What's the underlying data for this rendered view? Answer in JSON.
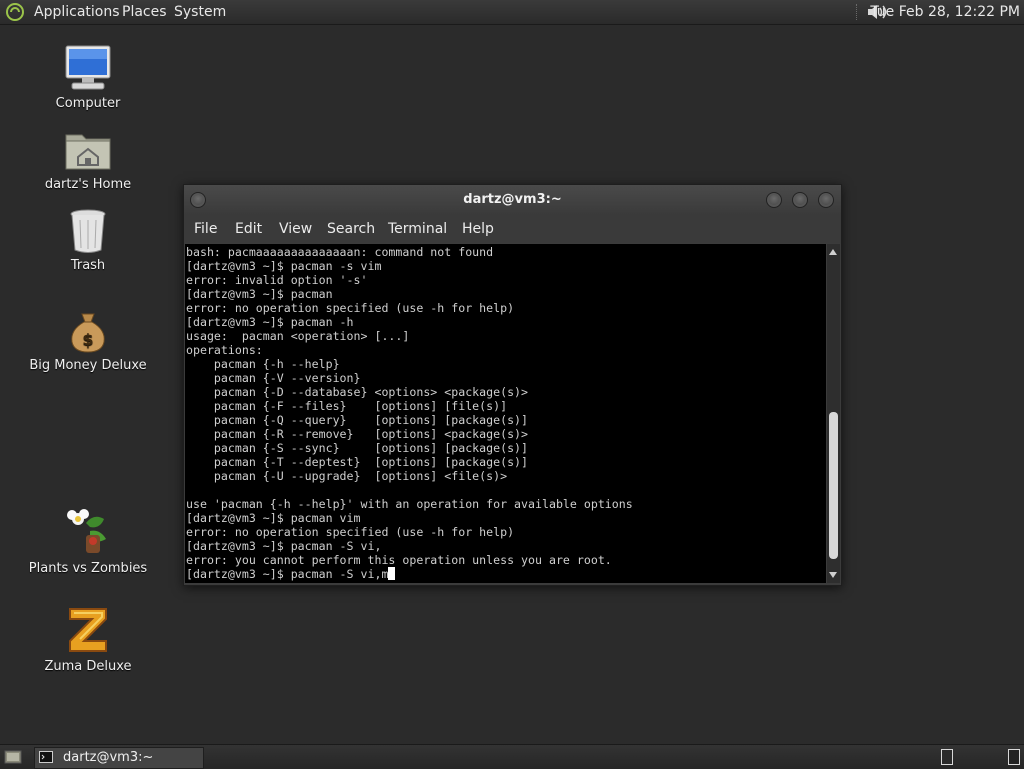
{
  "top_panel": {
    "menus": [
      "Applications",
      "Places",
      "System"
    ],
    "clock": "Tue Feb 28, 12:22 PM"
  },
  "desktop_icons": [
    {
      "label": "Computer",
      "icon": "computer-icon"
    },
    {
      "label": "dartz's Home",
      "icon": "home-folder-icon"
    },
    {
      "label": "Trash",
      "icon": "trash-icon"
    },
    {
      "label": "Big Money Deluxe",
      "icon": "money-bag-icon"
    },
    {
      "label": "Plants vs Zombies",
      "icon": "plants-vs-zombies-icon"
    },
    {
      "label": "Zuma Deluxe",
      "icon": "zuma-icon"
    }
  ],
  "terminal": {
    "title": "dartz@vm3:~",
    "menu": [
      "File",
      "Edit",
      "View",
      "Search",
      "Terminal",
      "Help"
    ],
    "lines": [
      "bash: pacmaaaaaaaaaaaaaan: command not found",
      "[dartz@vm3 ~]$ pacman -s vim",
      "error: invalid option '-s'",
      "[dartz@vm3 ~]$ pacman",
      "error: no operation specified (use -h for help)",
      "[dartz@vm3 ~]$ pacman -h",
      "usage:  pacman <operation> [...]",
      "operations:",
      "    pacman {-h --help}",
      "    pacman {-V --version}",
      "    pacman {-D --database} <options> <package(s)>",
      "    pacman {-F --files}    [options] [file(s)]",
      "    pacman {-Q --query}    [options] [package(s)]",
      "    pacman {-R --remove}   [options] <package(s)>",
      "    pacman {-S --sync}     [options] [package(s)]",
      "    pacman {-T --deptest}  [options] [package(s)]",
      "    pacman {-U --upgrade}  [options] <file(s)>",
      "",
      "use 'pacman {-h --help}' with an operation for available options",
      "[dartz@vm3 ~]$ pacman vim",
      "error: no operation specified (use -h for help)",
      "[dartz@vm3 ~]$ pacman -S vi,",
      "error: you cannot perform this operation unless you are root.",
      "[dartz@vm3 ~]$ pacman -S vi,m"
    ],
    "scroll_position": 0.95,
    "scroll_visible_fraction": 0.48
  },
  "taskbar": {
    "task_label": "dartz@vm3:~"
  },
  "colors": {
    "desktop_bg": "#2b2b2b",
    "terminal_bg": "#000000",
    "terminal_fg": "#cfcfcf"
  }
}
